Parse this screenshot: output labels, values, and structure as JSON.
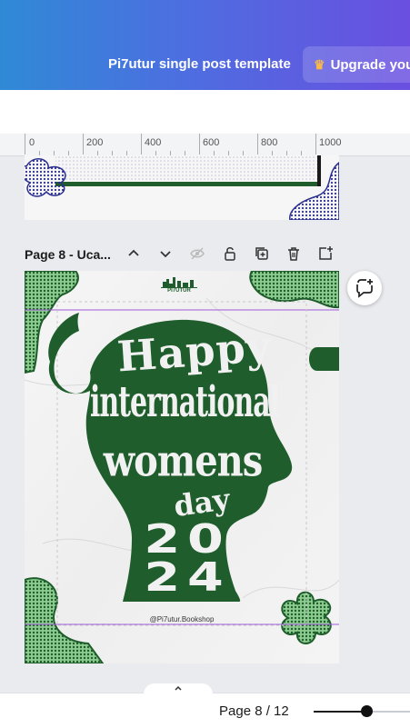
{
  "header": {
    "title": "Pi7utur single post template",
    "upgrade_label": "Upgrade your",
    "crown_icon": "crown-icon"
  },
  "ruler": {
    "labels": [
      "0",
      "200",
      "400",
      "600",
      "800",
      "1000"
    ]
  },
  "page": {
    "label": "Page 8 - Uca...",
    "actions": [
      "move-up",
      "move-down",
      "hide",
      "lock",
      "duplicate",
      "delete",
      "add-page"
    ]
  },
  "design": {
    "logo_text": "PI7UTUR",
    "line1": "Happy",
    "line2": "international",
    "line3": "womens",
    "line4": "day",
    "year_top": "20",
    "year_bottom": "24",
    "handle": "@Pi7utur.Bookshop",
    "green": "#1f5e2c",
    "light_green": "#7bbf80"
  },
  "footer": {
    "page_counter": "Page 8 / 12",
    "zoom_fraction": 0.5
  }
}
